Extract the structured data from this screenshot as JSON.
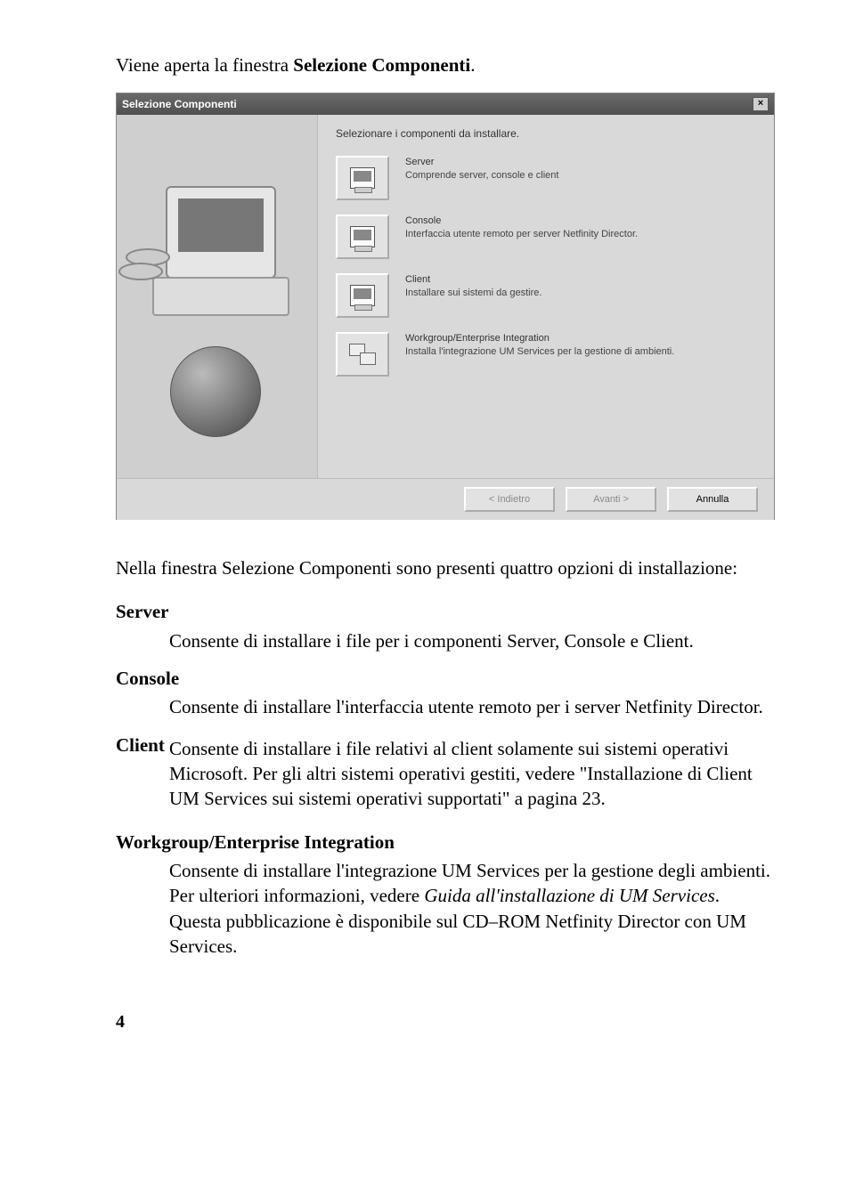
{
  "intro_prefix": "Viene aperta la finestra ",
  "intro_bold": "Selezione Componenti",
  "intro_suffix": ".",
  "dialog": {
    "title": "Selezione Componenti",
    "close_glyph": "×",
    "instruction": "Selezionare i componenti da installare.",
    "options": [
      {
        "title": "Server",
        "desc": "Comprende server, console e client"
      },
      {
        "title": "Console",
        "desc": "Interfaccia utente remoto per server Netfinity Director."
      },
      {
        "title": "Client",
        "desc": "Installare sui sistemi da gestire."
      },
      {
        "title": "Workgroup/Enterprise Integration",
        "desc": "Installa l'integrazione UM Services per la gestione di ambienti."
      }
    ],
    "buttons": {
      "back": "< Indietro",
      "next": "Avanti >",
      "cancel": "Annulla"
    }
  },
  "body": {
    "lead": "Nella finestra Selezione Componenti sono presenti quattro opzioni di installazione:",
    "server_label": "Server",
    "server_desc": "Consente di installare i file per i componenti Server, Console e Client.",
    "console_label": "Console",
    "console_desc": "Consente di installare l'interfaccia utente remoto per i server Netfinity Director.",
    "client_label": "Client",
    "client_desc": "Consente di installare i file relativi al client solamente sui sistemi operativi Microsoft. Per gli altri sistemi operativi gestiti, vedere \"Installazione di Client UM Services sui sistemi operativi supportati\" a pagina 23.",
    "wg_label": "Workgroup/Enterprise Integration",
    "wg_desc_1": "Consente di installare l'integrazione UM Services per la gestione degli ambienti. Per ulteriori informazioni, vedere ",
    "wg_desc_italic": "Guida all'installazione di UM Services",
    "wg_desc_2": ". Questa pubblicazione è disponibile sul CD–ROM Netfinity Director con UM Services."
  },
  "page_number": "4"
}
